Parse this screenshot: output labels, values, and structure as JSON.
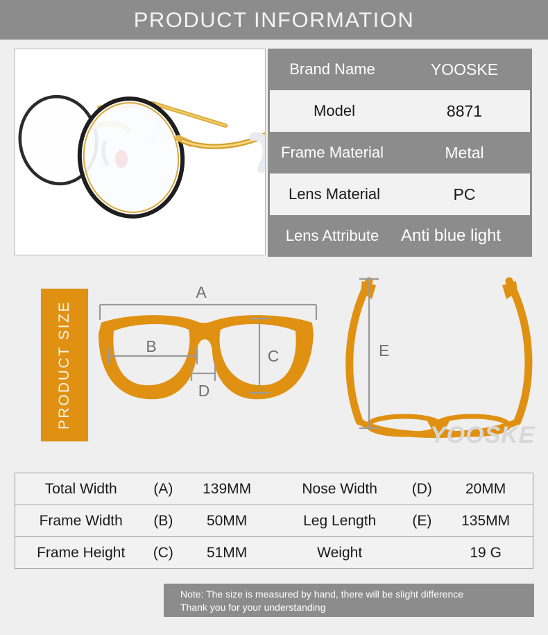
{
  "header": {
    "title": "PRODUCT INFORMATION"
  },
  "product_photo": {
    "alt": "round metal eyeglasses, gold temples with black rims and white tips"
  },
  "spec_table": {
    "rows": [
      {
        "label": "Brand Name",
        "value": "YOOSKE"
      },
      {
        "label": "Model",
        "value": "8871"
      },
      {
        "label": "Frame Material",
        "value": "Metal"
      },
      {
        "label": "Lens Material",
        "value": "PC"
      },
      {
        "label": "Lens Attribute",
        "value": "Anti blue light"
      }
    ]
  },
  "size_section": {
    "banner_label": "PRODUCT SIZE",
    "watermark": "YOOSKE",
    "front_markers": [
      {
        "id": "A",
        "meaning": "total width"
      },
      {
        "id": "B",
        "meaning": "frame width"
      },
      {
        "id": "C",
        "meaning": "frame height"
      },
      {
        "id": "D",
        "meaning": "nose width"
      }
    ],
    "side_markers": [
      {
        "id": "E",
        "meaning": "leg length"
      }
    ]
  },
  "measure_table": {
    "rows": [
      {
        "left": {
          "label": "Total Width",
          "code": "(A)",
          "value": "139MM"
        },
        "right": {
          "label": "Nose Width",
          "code": "(D)",
          "value": "20MM"
        }
      },
      {
        "left": {
          "label": "Frame Width",
          "code": "(B)",
          "value": "50MM"
        },
        "right": {
          "label": "Leg Length",
          "code": "(E)",
          "value": "135MM"
        }
      },
      {
        "left": {
          "label": "Frame Height",
          "code": "(C)",
          "value": "51MM"
        },
        "right": {
          "label": "Weight",
          "code": "",
          "value": "19 G"
        }
      }
    ]
  },
  "note": {
    "line1": "Note: The size is measured by hand, there will be slight difference",
    "line2": "Thank you for your understanding"
  },
  "colors": {
    "header_gray": "#8c8c8c",
    "page_background": "#efefef",
    "orange": "#e09112",
    "code_red": "#e60000",
    "cell_white": "#f2f2f2"
  }
}
